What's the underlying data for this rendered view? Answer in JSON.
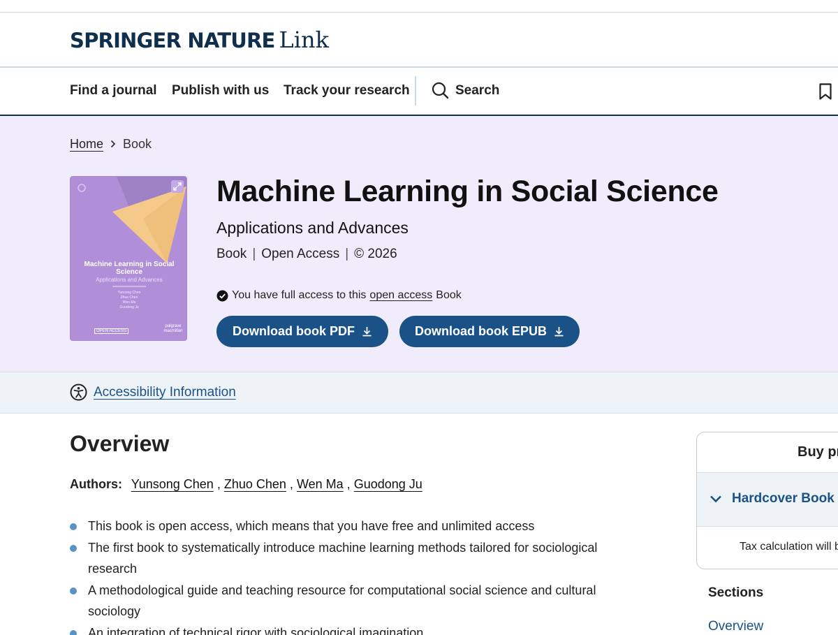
{
  "site": {
    "brand": "SPRINGER NATURE",
    "brand_suffix": "Link",
    "nav": [
      "Find a journal",
      "Publish with us",
      "Track your research"
    ],
    "search_label": "Search",
    "icons": [
      "search-icon",
      "bookmark-icon"
    ]
  },
  "breadcrumb": {
    "home": "Home",
    "current": "Book"
  },
  "cover": {
    "title": "Machine Learning in Social Science",
    "subtitle": "Applications and Advances",
    "authors": [
      "Yunsong Chen",
      "Zhuo Chen",
      "Wen Ma",
      "Guodong Ju"
    ],
    "badge": "OPEN ACCESS",
    "publisher": "palgrave macmillan",
    "colors": {
      "background": "#b18fd8",
      "triangle": "#f5c98a",
      "triangle_dark": "#9a7cc0"
    }
  },
  "book": {
    "title": "Machine Learning in Social Science",
    "subtitle": "Applications and Advances",
    "type": "Book",
    "access": "Open Access",
    "copyright": "© 2026",
    "access_note_prefix": "You have full access to this",
    "access_note_link": "open access",
    "access_note_suffix": "Book"
  },
  "buttons": {
    "pdf": "Download book PDF",
    "epub": "Download book EPUB"
  },
  "accessibility": {
    "label": "Accessibility Information"
  },
  "overview": {
    "heading": "Overview",
    "authors_label": "Authors:",
    "authors": [
      "Yunsong Chen",
      "Zhuo Chen",
      "Wen Ma",
      "Guodong Ju"
    ],
    "bullets": [
      "This book is open access, which means that you have free and unlimited access",
      "The first book to systematically introduce machine learning methods tailored for sociological research",
      "A methodological guide and teaching resource for computational social science and cultural sociology",
      "An integration of technical rigor with sociological imagination"
    ]
  },
  "buy": {
    "title": "Buy pr",
    "hardcover": "Hardcover Book",
    "tax_note": "Tax calculation will b"
  },
  "sections": {
    "heading": "Sections",
    "first": "Overview"
  },
  "colors": {
    "accent": "#1a5288",
    "brand_navy": "#0f2f4d",
    "hero_bg": "#f1ecfb",
    "bullet": "#5a92c8"
  }
}
